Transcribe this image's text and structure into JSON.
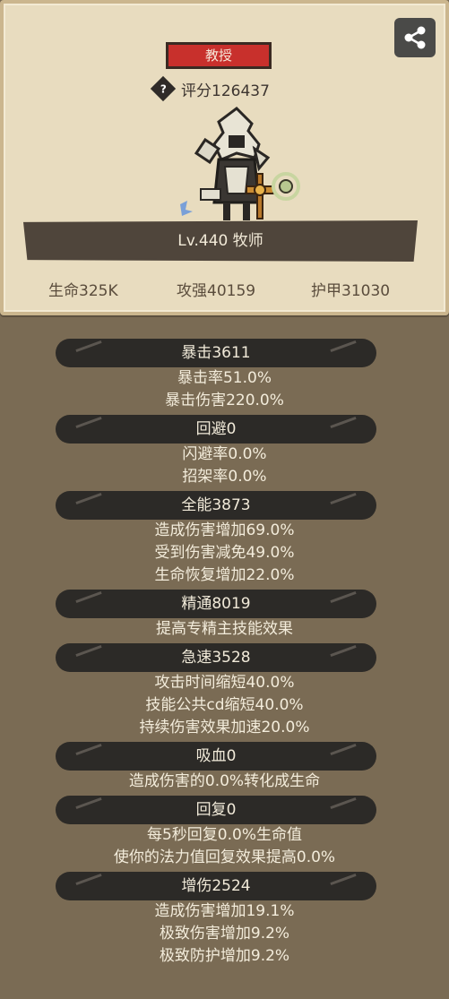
{
  "profile": {
    "title_badge": "教授",
    "score": "评分126437",
    "level": "Lv.440 牧师",
    "stats": [
      "生命325K",
      "攻强40159",
      "护甲31030"
    ]
  },
  "sections": [
    {
      "header": "暴击3611",
      "lines": [
        "暴击率51.0%",
        "暴击伤害220.0%"
      ]
    },
    {
      "header": "回避0",
      "lines": [
        "闪避率0.0%",
        "招架率0.0%"
      ]
    },
    {
      "header": "全能3873",
      "lines": [
        "造成伤害增加69.0%",
        "受到伤害减免49.0%",
        "生命恢复增加22.0%"
      ]
    },
    {
      "header": "精通8019",
      "lines": [
        "提高专精主技能效果"
      ]
    },
    {
      "header": "急速3528",
      "lines": [
        "攻击时间缩短40.0%",
        "技能公共cd缩短40.0%",
        "持续伤害效果加速20.0%"
      ]
    },
    {
      "header": "吸血0",
      "lines": [
        "造成伤害的0.0%转化成生命"
      ]
    },
    {
      "header": "回复0",
      "lines": [
        "每5秒回复0.0%生命值",
        "使你的法力值回复效果提高0.0%"
      ]
    },
    {
      "header": "增伤2524",
      "lines": [
        "造成伤害增加19.1%",
        "极致伤害增加9.2%",
        "极致防护增加9.2%"
      ]
    }
  ],
  "icons": {
    "share": "share-icon",
    "help": "help-icon",
    "hero": "priest-hero-icon"
  }
}
